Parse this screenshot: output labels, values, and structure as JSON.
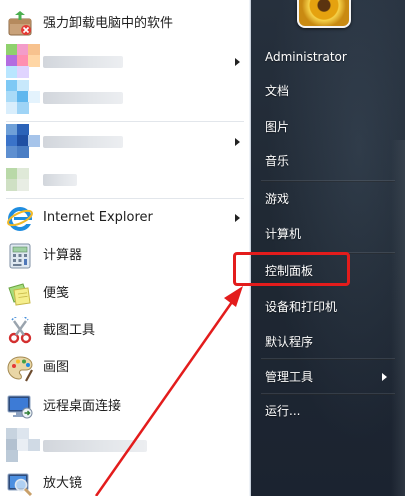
{
  "left_menu": {
    "items": [
      {
        "label": "强力卸载电脑中的软件",
        "icon": "uninstall-box-icon",
        "has_submenu": false
      },
      {
        "label": "",
        "icon": "pixelated-app-icon",
        "has_submenu": true
      },
      {
        "label": "",
        "icon": "pixelated-app-icon",
        "has_submenu": false
      },
      {
        "label": "",
        "icon": "pixelated-app-icon",
        "has_submenu": true
      },
      {
        "label": "",
        "icon": "pixelated-app-icon",
        "has_submenu": false
      },
      {
        "label": "Internet Explorer",
        "icon": "internet-explorer-icon",
        "has_submenu": true
      },
      {
        "label": "计算器",
        "icon": "calculator-icon",
        "has_submenu": false
      },
      {
        "label": "便笺",
        "icon": "sticky-notes-icon",
        "has_submenu": false
      },
      {
        "label": "截图工具",
        "icon": "snipping-tool-icon",
        "has_submenu": false
      },
      {
        "label": "画图",
        "icon": "paint-palette-icon",
        "has_submenu": false
      },
      {
        "label": "远程桌面连接",
        "icon": "remote-desktop-icon",
        "has_submenu": false
      },
      {
        "label": "",
        "icon": "pixelated-app-icon",
        "has_submenu": false
      },
      {
        "label": "放大镜",
        "icon": "magnifier-icon",
        "has_submenu": false
      }
    ]
  },
  "right_menu": {
    "user": "Administrator",
    "items": [
      {
        "label": "文档",
        "has_submenu": false
      },
      {
        "label": "图片",
        "has_submenu": false
      },
      {
        "label": "音乐",
        "has_submenu": false
      },
      {
        "label": "游戏",
        "has_submenu": false
      },
      {
        "label": "计算机",
        "has_submenu": false
      },
      {
        "label": "控制面板",
        "has_submenu": false
      },
      {
        "label": "设备和打印机",
        "has_submenu": false
      },
      {
        "label": "默认程序",
        "has_submenu": false
      },
      {
        "label": "管理工具",
        "has_submenu": true
      },
      {
        "label": "运行...",
        "has_submenu": false
      }
    ]
  },
  "annotation": {
    "highlight_color": "#e31c1c",
    "highlighted_item": "控制面板"
  }
}
